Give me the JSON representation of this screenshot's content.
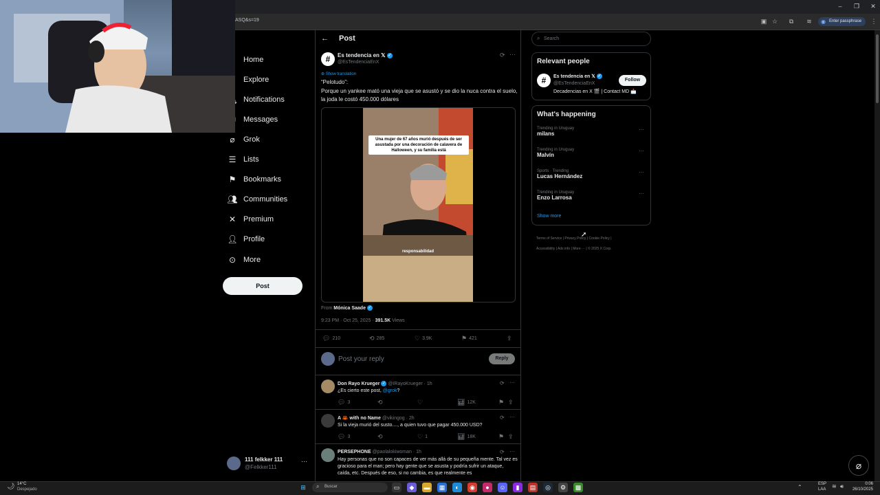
{
  "browser": {
    "url_fragment": "ASQ&s=19",
    "pass_button": "Enter passphrase"
  },
  "nav": {
    "items": [
      {
        "label": "Home",
        "icon": "home-icon"
      },
      {
        "label": "Explore",
        "icon": "search-icon"
      },
      {
        "label": "Notifications",
        "icon": "bell-icon"
      },
      {
        "label": "Messages",
        "icon": "mail-icon"
      },
      {
        "label": "Grok",
        "icon": "grok-icon"
      },
      {
        "label": "Lists",
        "icon": "list-icon"
      },
      {
        "label": "Bookmarks",
        "icon": "bookmark-icon"
      },
      {
        "label": "Communities",
        "icon": "people-icon"
      },
      {
        "label": "Premium",
        "icon": "x-icon"
      },
      {
        "label": "Profile",
        "icon": "person-icon"
      },
      {
        "label": "More",
        "icon": "more-circle-icon"
      }
    ],
    "post_button": "Post",
    "account": {
      "name": "111 felkker 111",
      "handle": "@Felkker111"
    }
  },
  "main": {
    "header_title": "Post",
    "tweet": {
      "author": "Es tendencia en 𝕏",
      "handle": "@EsTendenciaEnX",
      "show_translation": "Show translation",
      "text_line1": "“Pelotudo”:",
      "text_line2": "Porque un yankee mató una vieja que se asustó y se dio la nuca contra el suelo, la joda le costó 450.000 dólares",
      "media_caption": "Una mujer de 67 años murió después de ser asustada por una decoración de calavera de Halloween, y su familia está",
      "media_subtitle": "responsabilidad",
      "from_label": "From",
      "from_name": "Mónica Saade",
      "timestamp": "9:23 PM · Oct 25, 2025 ·",
      "views": "391.5K",
      "views_label": "Views",
      "stats": {
        "replies": "210",
        "reposts": "285",
        "likes": "3.9K",
        "bookmarks": "421"
      }
    },
    "reply_placeholder": "Post your reply",
    "reply_button": "Reply",
    "replies": [
      {
        "author": "Don Rayo Krueger",
        "handle": "@IRayoKrueger · 1h",
        "text": "¿Es cierto este post, ",
        "mention": "@grok",
        "text_end": "?",
        "replies": "3",
        "reposts": "",
        "likes": "",
        "views": "12K"
      },
      {
        "author": "A 🦀 with no Name",
        "handle": "@vikingog · 2h",
        "text": "Si la vieja murió del susto...., a quien tuvo que pagar 450.000 USD?",
        "replies": "3",
        "reposts": "",
        "likes": "1",
        "views": "18K"
      },
      {
        "author": "PERSEPHONE",
        "handle": "@paolalokiwoman · 1h",
        "text": "Hay personas que no son capaces de ver más allá de su pequeña mente. Tal vez es gracioso para el man; pero hay gente que se asusta y podría sufrir un ataque, caída, etc. Después de eso, si no cambia, es que realmente es"
      }
    ]
  },
  "right": {
    "search_placeholder": "Search",
    "relevant_title": "Relevant people",
    "relevant": {
      "name": "Es tendencia en 𝕏",
      "handle": "@EsTendenciaEnX",
      "bio": "Decadencias en X 🎬 | Contact MD 📩",
      "follow": "Follow"
    },
    "happening_title": "What's happening",
    "trends": [
      {
        "category": "Trending in Uruguay",
        "name": "milans"
      },
      {
        "category": "Trending in Uruguay",
        "name": "Malvín"
      },
      {
        "category": "Sports · Trending",
        "name": "Lucas Hernández"
      },
      {
        "category": "Trending in Uruguay",
        "name": "Enzo Larrosa"
      }
    ],
    "show_more": "Show more",
    "footer": [
      "Terms of Service",
      "Privacy Policy",
      "Cookie Policy",
      "Accessibility",
      "Ads info",
      "More ···",
      "© 2025 X Corp."
    ]
  },
  "taskbar": {
    "weather_temp": "14°C",
    "weather_desc": "Despejado",
    "search": "Buscar",
    "lang1": "ESP",
    "lang2": "LAA",
    "time": "0:06",
    "date": "26/10/2025"
  }
}
